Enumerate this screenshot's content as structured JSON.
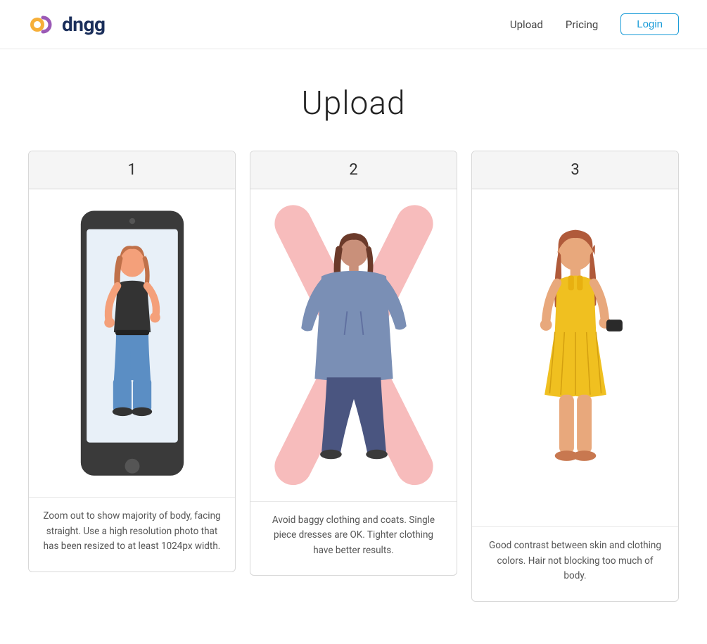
{
  "header": {
    "logo_text": "dngg",
    "nav": {
      "upload_label": "Upload",
      "pricing_label": "Pricing",
      "login_label": "Login"
    }
  },
  "main": {
    "page_title": "Upload",
    "cards": [
      {
        "number": "1",
        "caption": "Zoom out to show majority of body, facing straight. Use a high resolution photo that has been resized to at least 1024px width."
      },
      {
        "number": "2",
        "caption": "Avoid baggy clothing and coats. Single piece dresses are OK. Tighter clothing have better results."
      },
      {
        "number": "3",
        "caption": "Good contrast between skin and clothing colors. Hair not blocking too much of body."
      }
    ]
  }
}
